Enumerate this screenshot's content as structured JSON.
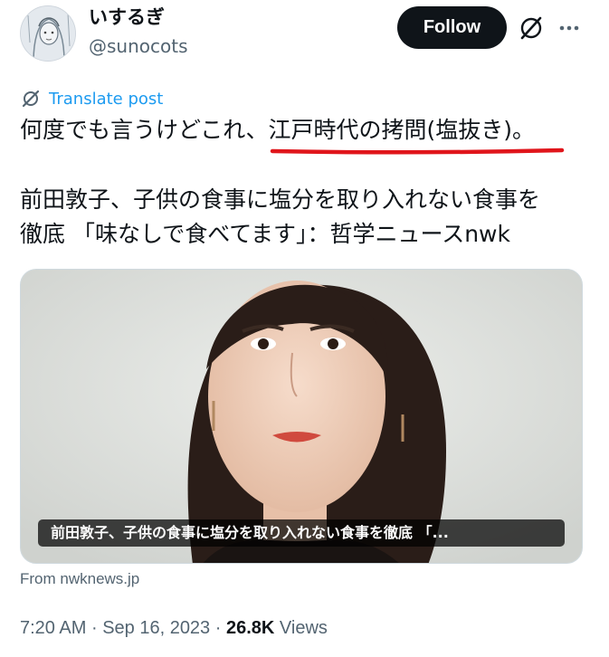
{
  "author": {
    "display_name": "いするぎ",
    "handle": "@sunocots",
    "avatar_icon": "sketch-portrait-avatar"
  },
  "actions": {
    "follow_label": "Follow",
    "grok_icon": "grok-icon",
    "more_icon": "more-horizontal-icon"
  },
  "translate_label": "Translate post",
  "post": {
    "line1": "何度でも言うけどこれ、江戸時代の拷問(塩抜き)。",
    "line2": "前田敦子、子供の食事に塩分を取り入れない食事を",
    "line3": "徹底 「味なしで食べてます」：哲学ニュースnwk",
    "highlight_color": "#e0151b"
  },
  "card": {
    "caption": "前田敦子、子供の食事に塩分を取り入れない食事を徹底 「...",
    "source": "From nwknews.jp"
  },
  "meta": {
    "time": "7:20 AM",
    "date": "Sep 16, 2023",
    "views_count": "26.8K",
    "views_label": "Views"
  },
  "colors": {
    "link_blue": "#1d9bf0",
    "secondary_text": "#536471",
    "primary_text": "#0f1419"
  }
}
